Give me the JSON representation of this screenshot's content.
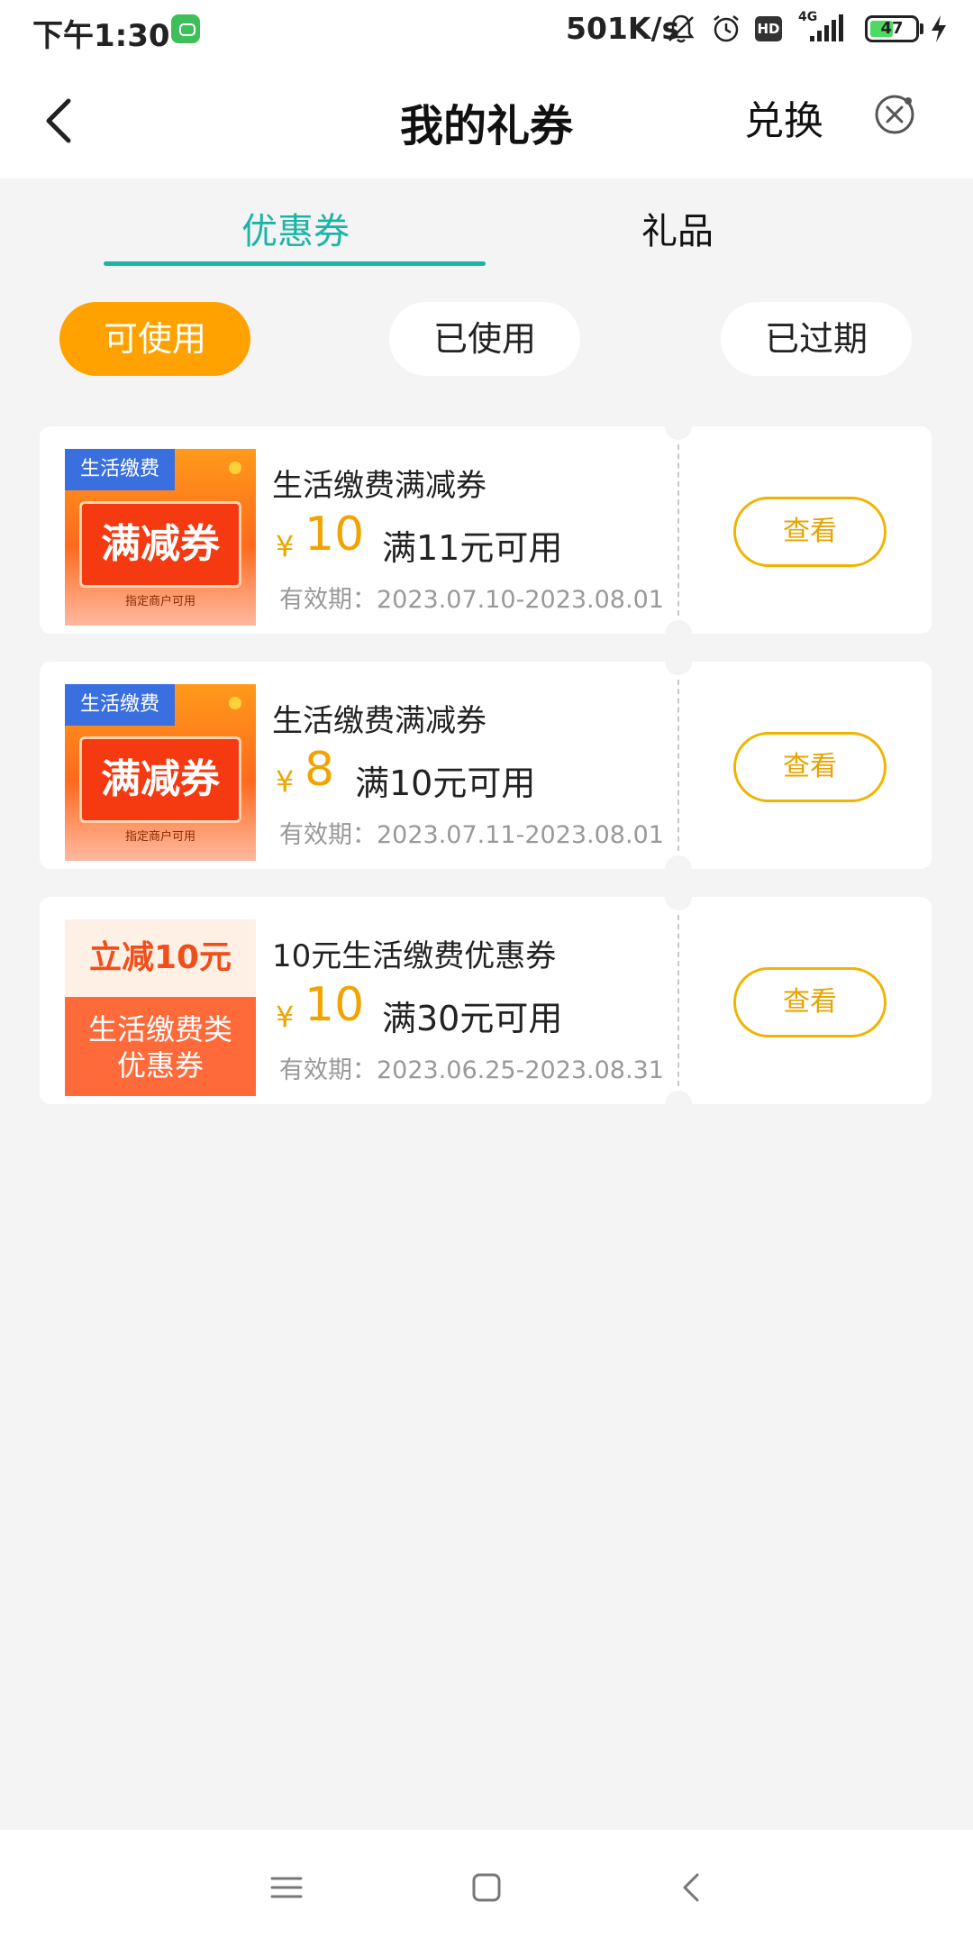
{
  "status_bar": {
    "time": "下午1:30",
    "net_speed": "501K/s",
    "hd_label": "HD",
    "network_type": "4G",
    "battery_level": "47"
  },
  "header": {
    "title": "我的礼券",
    "exchange_label": "兑换"
  },
  "tabs": [
    {
      "label": "优惠券",
      "active": true
    },
    {
      "label": "礼品",
      "active": false
    }
  ],
  "filters": [
    {
      "label": "可使用",
      "active": true
    },
    {
      "label": "已使用",
      "active": false
    },
    {
      "label": "已过期",
      "active": false
    }
  ],
  "coupons": [
    {
      "thumb": {
        "tag": "生活缴费",
        "main": "满减券",
        "small": "指定商户可用"
      },
      "title": "生活缴费满减券",
      "currency": "¥",
      "amount": "10",
      "condition": "满11元可用",
      "validity": "有效期：2023.07.10-2023.08.01",
      "button": "查看"
    },
    {
      "thumb": {
        "tag": "生活缴费",
        "main": "满减券",
        "small": "指定商户可用"
      },
      "title": "生活缴费满减券",
      "currency": "¥",
      "amount": "8",
      "condition": "满10元可用",
      "validity": "有效期：2023.07.11-2023.08.01",
      "button": "查看"
    },
    {
      "thumb": {
        "top": "立减10元",
        "line1": "生活缴费类",
        "line2": "优惠券"
      },
      "title": "10元生活缴费优惠券",
      "currency": "¥",
      "amount": "10",
      "condition": "满30元可用",
      "validity": "有效期：2023.06.25-2023.08.31",
      "button": "查看"
    }
  ],
  "colors": {
    "accent": "#1bb5a6",
    "active_pill": "#ffa200",
    "amount": "#f0a400",
    "button_border": "#f0b400",
    "background": "#f4f4f4"
  },
  "icons": {
    "back": "back-arrow-icon",
    "close": "close-circle-icon",
    "nav_menu": "menu-icon",
    "nav_home": "home-square-icon",
    "nav_back": "nav-back-icon"
  }
}
